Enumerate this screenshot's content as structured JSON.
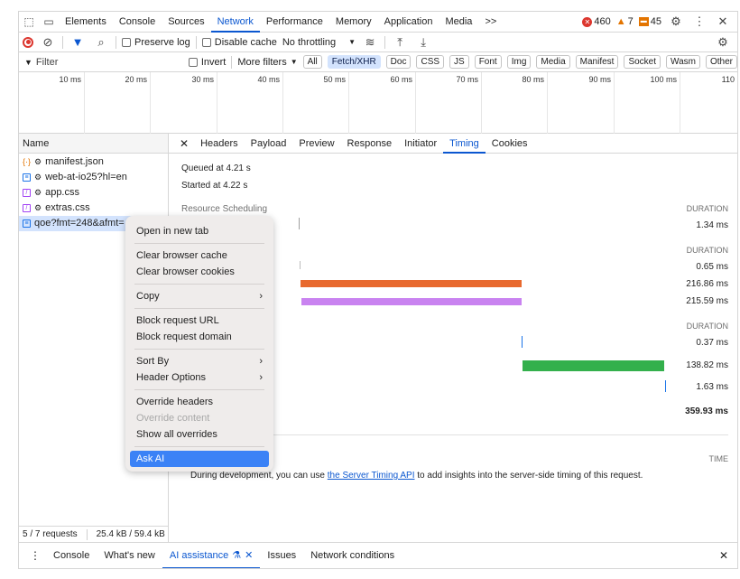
{
  "tabs": {
    "items": [
      "Elements",
      "Console",
      "Sources",
      "Network",
      "Performance",
      "Memory",
      "Application",
      "Media"
    ],
    "active": "Network",
    "more": ">>",
    "errors": "460",
    "warnings": "7",
    "issues": "45"
  },
  "toolbar": {
    "preserve_log": "Preserve log",
    "disable_cache": "Disable cache",
    "throttling": "No throttling"
  },
  "filterbar": {
    "filter_placeholder": "Filter",
    "invert": "Invert",
    "more_filters": "More filters",
    "types": [
      "All",
      "Fetch/XHR",
      "Doc",
      "CSS",
      "JS",
      "Font",
      "Img",
      "Media",
      "Manifest",
      "Socket",
      "Wasm",
      "Other"
    ],
    "selected_type": "Fetch/XHR"
  },
  "timeline": {
    "ticks": [
      "10 ms",
      "20 ms",
      "30 ms",
      "40 ms",
      "50 ms",
      "60 ms",
      "70 ms",
      "80 ms",
      "90 ms",
      "100 ms",
      "110"
    ]
  },
  "requests": {
    "header": "Name",
    "items": [
      {
        "name": "manifest.json",
        "type": "json"
      },
      {
        "name": "web-at-io25?hl=en",
        "type": "doc"
      },
      {
        "name": "app.css",
        "type": "css"
      },
      {
        "name": "extras.css",
        "type": "css"
      },
      {
        "name": "qoe?fmt=248&afmt=",
        "type": "doc"
      }
    ],
    "status_count": "5 / 7 requests",
    "status_size": "25.4 kB / 59.4 kB"
  },
  "details": {
    "tabs": [
      "Headers",
      "Payload",
      "Preview",
      "Response",
      "Initiator",
      "Timing",
      "Cookies"
    ],
    "active_tab": "Timing",
    "queued": "Queued at 4.21 s",
    "started": "Started at 4.22 s",
    "resource_scheduling": "Resource Scheduling",
    "duration_label": "DURATION",
    "time_label": "TIME",
    "durations": [
      "1.34 ms",
      "0.65 ms",
      "216.86 ms",
      "215.59 ms",
      "0.37 ms",
      "138.82 ms",
      "1.63 ms"
    ],
    "total": "359.93 ms",
    "server_note_pre": "During development, you can use ",
    "server_note_link": "the Server Timing API",
    "server_note_post": " to add insights into the server-side timing of this request.",
    "colors": {
      "orange": "#e8692e",
      "purple": "#c983f0",
      "green": "#33b04c",
      "blue": "#1a73e8"
    }
  },
  "context_menu": {
    "open_new_tab": "Open in new tab",
    "clear_cache": "Clear browser cache",
    "clear_cookies": "Clear browser cookies",
    "copy": "Copy",
    "block_url": "Block request URL",
    "block_domain": "Block request domain",
    "sort_by": "Sort By",
    "header_options": "Header Options",
    "override_headers": "Override headers",
    "override_content": "Override content",
    "show_overrides": "Show all overrides",
    "ask_ai": "Ask AI"
  },
  "drawer": {
    "items": [
      "Console",
      "What's new",
      "AI assistance",
      "Issues",
      "Network conditions"
    ],
    "active": "AI assistance"
  }
}
